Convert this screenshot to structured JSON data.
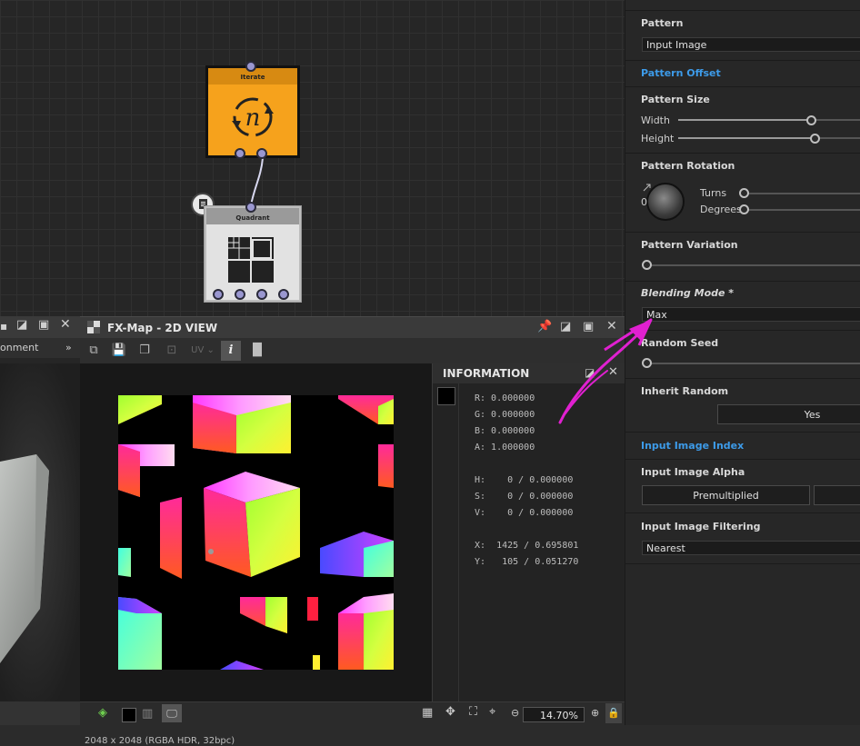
{
  "graph": {
    "nodes": [
      {
        "title": "Iterate",
        "glyph": "n"
      },
      {
        "title": "Quadrant"
      }
    ]
  },
  "left_panel": {
    "tab_label_fragment": "onment"
  },
  "view2d": {
    "title": "FX-Map - 2D VIEW",
    "uv_label": "UV",
    "status": "2048 x 2048 (RGBA HDR, 32bpc)",
    "zoom": "14.70%"
  },
  "information": {
    "title": "INFORMATION",
    "rows": [
      "R: 0.000000",
      "G: 0.000000",
      "B: 0.000000",
      "A: 1.000000",
      "H:    0 / 0.000000",
      "S:    0 / 0.000000",
      "V:    0 / 0.000000",
      "X:  1425 / 0.695801",
      "Y:   105 / 0.051270"
    ]
  },
  "properties": {
    "pattern": {
      "label": "Pattern",
      "value": "Input Image"
    },
    "pattern_offset": {
      "label": "Pattern Offset"
    },
    "pattern_size": {
      "label": "Pattern Size",
      "width_label": "Width",
      "height_label": "Height",
      "width_value": 0.68,
      "height_value": 0.7
    },
    "pattern_rotation": {
      "label": "Pattern Rotation",
      "dial_value": "0",
      "turns_label": "Turns",
      "degrees_label": "Degrees"
    },
    "pattern_variation": {
      "label": "Pattern Variation"
    },
    "blending_mode": {
      "label": "Blending Mode *",
      "value": "Max"
    },
    "random_seed": {
      "label": "Random Seed"
    },
    "inherit_random": {
      "label": "Inherit Random",
      "value": "Yes"
    },
    "input_image_index": {
      "label": "Input Image Index"
    },
    "input_image_alpha": {
      "label": "Input Image Alpha",
      "value": "Premultiplied"
    },
    "input_image_filtering": {
      "label": "Input Image Filtering",
      "value": "Nearest"
    }
  },
  "colors": {
    "accent_blue": "#3d9be9",
    "iterate_orange": "#f6a21c",
    "annotation_magenta": "#e020d0"
  }
}
